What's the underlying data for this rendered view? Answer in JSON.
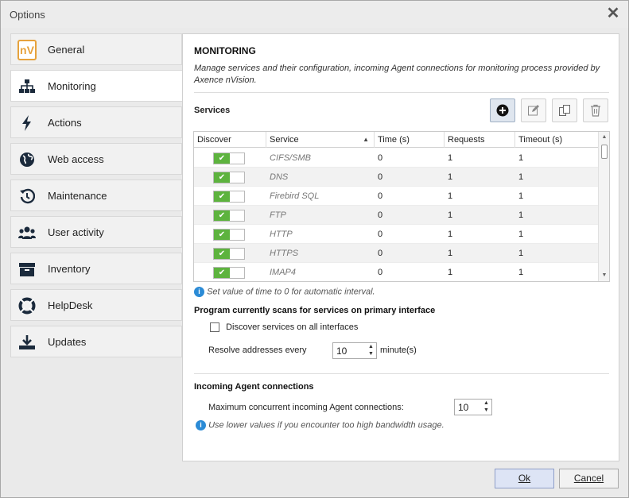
{
  "window": {
    "title": "Options"
  },
  "sidebar": {
    "items": [
      {
        "label": "General",
        "icon": "nv-logo",
        "logo_text": "nV"
      },
      {
        "label": "Monitoring",
        "icon": "network-icon"
      },
      {
        "label": "Actions",
        "icon": "bolt-icon"
      },
      {
        "label": "Web access",
        "icon": "globe-icon"
      },
      {
        "label": "Maintenance",
        "icon": "history-icon"
      },
      {
        "label": "User activity",
        "icon": "users-icon"
      },
      {
        "label": "Inventory",
        "icon": "archive-icon"
      },
      {
        "label": "HelpDesk",
        "icon": "lifebuoy-icon"
      },
      {
        "label": "Updates",
        "icon": "download-icon"
      }
    ],
    "active_index": 1
  },
  "main": {
    "title": "MONITORING",
    "description": "Manage services and their configuration, incoming Agent connections for monitoring process provided by Axence nVision.",
    "services_label": "Services",
    "toolbar": [
      "add-icon",
      "edit-icon",
      "copy-icon",
      "delete-icon"
    ],
    "table": {
      "columns": [
        "Discover",
        "Service",
        "Time (s)",
        "Requests",
        "Timeout (s)"
      ],
      "rows": [
        {
          "discover": true,
          "service": "CIFS/SMB",
          "time": "0",
          "requests": "1",
          "timeout": "1"
        },
        {
          "discover": true,
          "service": "DNS",
          "time": "0",
          "requests": "1",
          "timeout": "1"
        },
        {
          "discover": true,
          "service": "Firebird SQL",
          "time": "0",
          "requests": "1",
          "timeout": "1"
        },
        {
          "discover": true,
          "service": "FTP",
          "time": "0",
          "requests": "1",
          "timeout": "1"
        },
        {
          "discover": true,
          "service": "HTTP",
          "time": "0",
          "requests": "1",
          "timeout": "1"
        },
        {
          "discover": true,
          "service": "HTTPS",
          "time": "0",
          "requests": "1",
          "timeout": "1"
        },
        {
          "discover": true,
          "service": "IMAP4",
          "time": "0",
          "requests": "1",
          "timeout": "1"
        }
      ]
    },
    "time_hint": "Set value of time to 0 for automatic interval.",
    "scan_title": "Program currently scans for services on primary interface",
    "discover_all_label": "Discover services on all interfaces",
    "discover_all_checked": false,
    "resolve_label": "Resolve addresses every",
    "resolve_value": "10",
    "resolve_unit": "minute(s)",
    "agent_title": "Incoming Agent connections",
    "max_conn_label": "Maximum concurrent incoming Agent connections:",
    "max_conn_value": "10",
    "bandwidth_hint": "Use lower values if you encounter too high bandwidth usage."
  },
  "footer": {
    "ok_label": "Ok",
    "cancel_label": "Cancel"
  },
  "colors": {
    "toggle_on": "#5db33e",
    "info": "#2b8bd6",
    "logo": "#e6a23c"
  }
}
